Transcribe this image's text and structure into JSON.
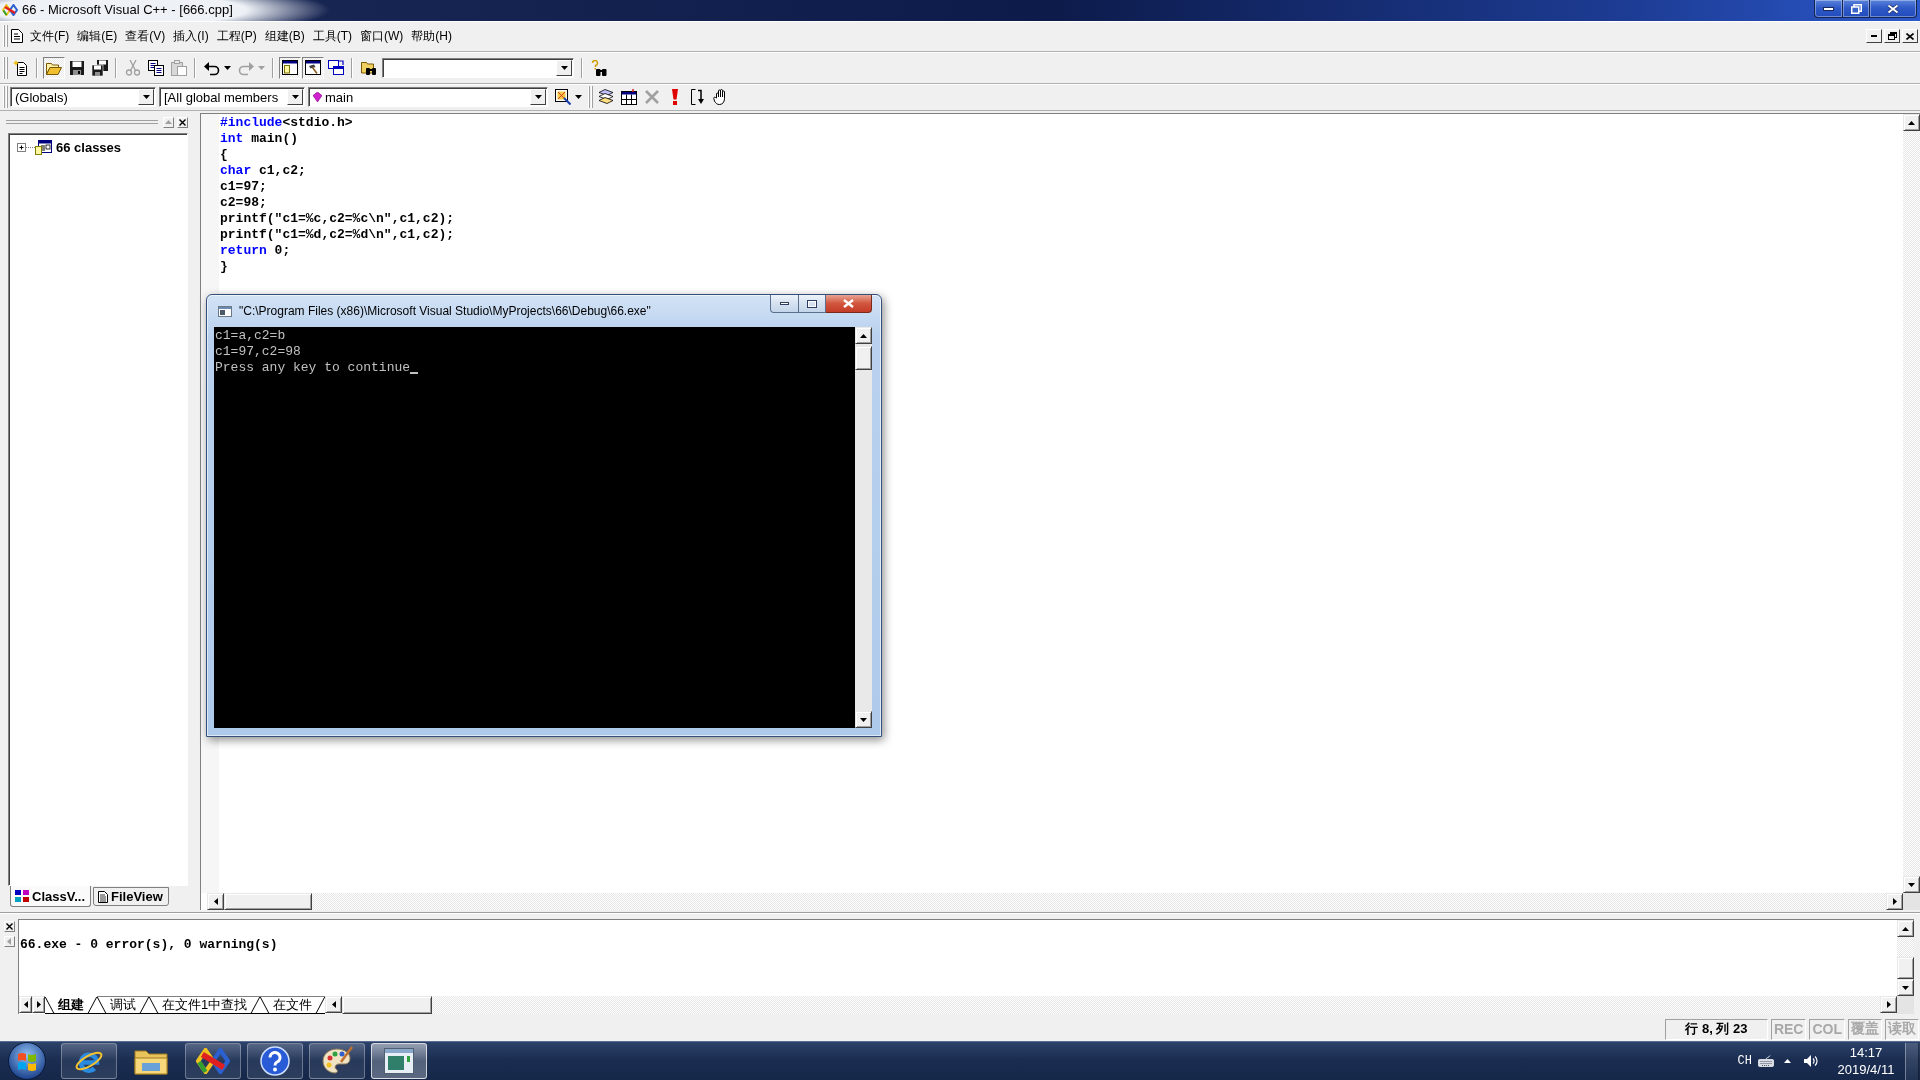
{
  "window": {
    "title": "66 - Microsoft Visual C++ - [666.cpp]"
  },
  "menu": [
    "文件(F)",
    "编辑(E)",
    "查看(V)",
    "插入(I)",
    "工程(P)",
    "组建(B)",
    "工具(T)",
    "窗口(W)",
    "帮助(H)"
  ],
  "toolbars": [
    {
      "buttons": [
        {
          "disabled": false,
          "pressed": false
        },
        {
          "disabled": false,
          "pressed": true
        },
        {
          "disabled": false,
          "pressed": false
        },
        {
          "disabled": false,
          "pressed": false
        },
        {
          "disabled": true,
          "pressed": false
        },
        {
          "disabled": false,
          "pressed": false
        },
        {
          "disabled": true,
          "pressed": false
        },
        {
          "disabled": false,
          "pressed": false
        },
        {
          "disabled": true,
          "pressed": false
        },
        {
          "disabled": false,
          "pressed": true
        },
        {
          "disabled": false,
          "pressed": true
        },
        {
          "disabled": false,
          "pressed": false
        },
        {
          "disabled": false,
          "pressed": false
        },
        {
          "disabled": false,
          "pressed": false
        }
      ]
    },
    {
      "buttons": [
        {
          "disabled": false
        },
        {
          "disabled": false
        },
        {
          "disabled": false
        },
        {
          "disabled": true
        },
        {
          "disabled": false
        },
        {
          "disabled": false
        },
        {
          "disabled": false
        }
      ]
    }
  ],
  "wizard_bar": {
    "class_combo": "(Globals)",
    "filter_combo": "[All global members",
    "function_combo": "main"
  },
  "workspace": {
    "tree": [
      {
        "label": "66 classes",
        "expanded": false
      }
    ],
    "tabs": [
      {
        "label": "ClassV...",
        "selected": true
      },
      {
        "label": "FileView",
        "selected": false
      }
    ]
  },
  "editor": {
    "lines": [
      {
        "tokens": [
          {
            "kind": "keyword",
            "text": "#include"
          },
          {
            "kind": "plain",
            "text": "<stdio.h>"
          }
        ]
      },
      {
        "tokens": [
          {
            "kind": "keyword",
            "text": "int"
          },
          {
            "kind": "plain",
            "text": " main()"
          }
        ]
      },
      {
        "tokens": [
          {
            "kind": "plain",
            "text": "{"
          }
        ]
      },
      {
        "tokens": [
          {
            "kind": "keyword",
            "text": "char"
          },
          {
            "kind": "plain",
            "text": " c1,c2;"
          }
        ]
      },
      {
        "tokens": [
          {
            "kind": "plain",
            "text": "c1=97;"
          }
        ]
      },
      {
        "tokens": [
          {
            "kind": "plain",
            "text": "c2=98;"
          }
        ]
      },
      {
        "tokens": [
          {
            "kind": "plain",
            "text": "printf(\"c1=%c,c2=%c\\n\",c1,c2);"
          }
        ]
      },
      {
        "tokens": [
          {
            "kind": "plain",
            "text": "printf(\"c1=%d,c2=%d\\n\",c1,c2);"
          }
        ]
      },
      {
        "tokens": [
          {
            "kind": "keyword",
            "text": "return"
          },
          {
            "kind": "plain",
            "text": " 0;"
          }
        ]
      },
      {
        "tokens": [
          {
            "kind": "plain",
            "text": "}"
          }
        ]
      }
    ]
  },
  "console": {
    "title": "\"C:\\Program Files (x86)\\Microsoft Visual Studio\\MyProjects\\66\\Debug\\66.exe\"",
    "lines": [
      "c1=a,c2=b",
      "c1=97,c2=98",
      "Press any key to continue"
    ]
  },
  "output": {
    "text": "66.exe - 0 error(s), 0 warning(s)",
    "tabs": [
      {
        "label": "组建",
        "selected": true
      },
      {
        "label": "调试",
        "selected": false
      },
      {
        "label": "在文件1中查找",
        "selected": false
      },
      {
        "label": "在文件",
        "selected": false
      }
    ]
  },
  "status_bar": {
    "position": "行 8, 列 23",
    "indicators": [
      {
        "label": "REC",
        "on": false
      },
      {
        "label": "COL",
        "on": false
      },
      {
        "label": "覆盖",
        "on": false
      },
      {
        "label": "读取",
        "on": false
      }
    ]
  },
  "taskbar": {
    "apps": [
      {
        "running": true,
        "selected": false
      },
      {
        "running": false,
        "selected": false
      },
      {
        "running": true,
        "selected": false
      },
      {
        "running": true,
        "selected": false
      },
      {
        "running": true,
        "selected": false
      },
      {
        "running": true,
        "selected": true
      }
    ],
    "language": "CH",
    "time": "14:17",
    "date": "2019/4/11"
  }
}
